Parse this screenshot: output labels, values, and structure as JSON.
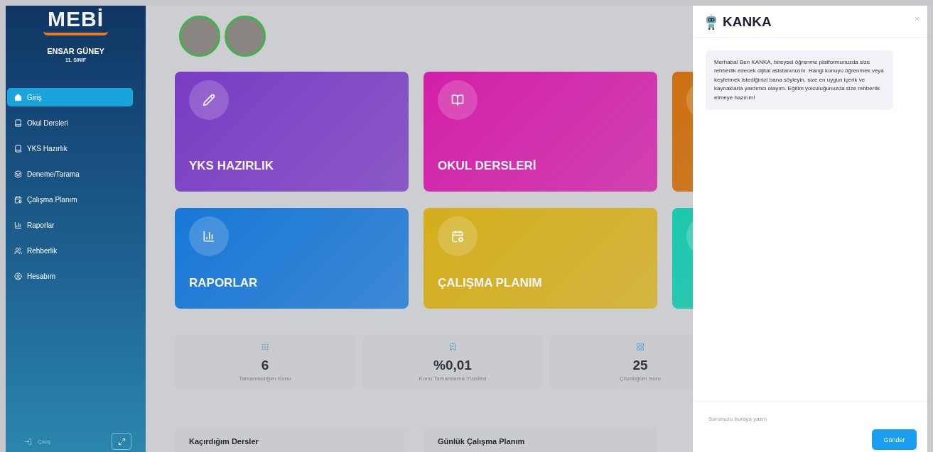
{
  "sidebar": {
    "logo": "MEBİ",
    "user_name": "ENSAR GÜNEY",
    "user_class": "11. SINIF",
    "items": [
      {
        "label": "Giriş",
        "selected": true
      },
      {
        "label": "Okul Dersleri",
        "selected": false
      },
      {
        "label": "YKS Hazırlık",
        "selected": false
      },
      {
        "label": "Deneme/Tarama",
        "selected": false
      },
      {
        "label": "Çalışma Planım",
        "selected": false
      },
      {
        "label": "Raporlar",
        "selected": false
      },
      {
        "label": "Rehberlik",
        "selected": false
      },
      {
        "label": "Hesabım",
        "selected": false
      }
    ],
    "logout": "Çıkış"
  },
  "tiles": [
    {
      "title": "YKS HAZIRLIK",
      "color": "#7a3cc4"
    },
    {
      "title": "OKUL DERSLERİ",
      "color": "#d21fa8"
    },
    {
      "color": "#cc7012"
    },
    {
      "title": "RAPORLAR",
      "color": "#1877d6"
    },
    {
      "title": "ÇALIŞMA PLANIM",
      "color": "#d4ae1c"
    },
    {
      "color": "#1cc8ad"
    }
  ],
  "stats": [
    {
      "value": "6",
      "label": "Tamamladığım Konu"
    },
    {
      "value": "%0,01",
      "label": "Konu Tamamlama Yüzdesi"
    },
    {
      "value": "25",
      "label": "Çözdüğüm Soru"
    }
  ],
  "panels": [
    {
      "title": "Kaçırdığım Dersler"
    },
    {
      "title": "Günlük Çalışma Planım"
    }
  ],
  "chat": {
    "title": "KANKA",
    "messages": [
      {
        "text": "Merhaba! Ben KANKA, bireysel öğrenme platformunuzda size rehberlik edecek dijital asistanınızım. Hangi konuyu öğrenmek veya keşfetmek istediğinizi bana söyleyin, size en uygun içerik ve kaynaklarla yardımcı olayım. Eğitim yolculuğunuzda size rehberlik etmeye hazırım!"
      }
    ],
    "input": {
      "placeholder": "Sorunuzu buraya yazın"
    },
    "send": "Gönder"
  }
}
